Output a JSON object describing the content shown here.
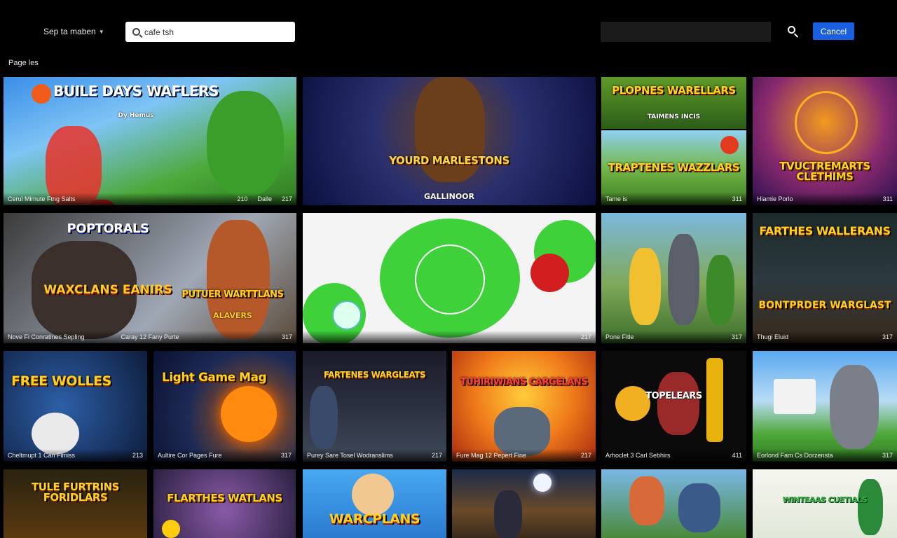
{
  "header": {
    "nav_label": "Sep ta maben",
    "search": {
      "value": "cafe tsh"
    },
    "cancel_label": "Cancel"
  },
  "section_title": "Page les",
  "tiles": [
    {
      "title": "BUILE DAYS WAFLERS",
      "sub": "Dy Hemus",
      "caption_left": "Cerul Mimute Ftng Salts",
      "caption_mid": "210",
      "caption_mid2": "Dalle",
      "caption_right": "217"
    },
    {
      "title": "YOURD MARLESTONS",
      "sub": "GALLINOOR",
      "caption_left": "",
      "caption_mid": "",
      "caption_right": ""
    },
    {
      "title": "PLOPNES WARELLARS",
      "sub": "TAIMENS INCIS",
      "caption_left": "",
      "caption_mid": "",
      "caption_right": ""
    },
    {
      "title": "TRAPTENES WAZZLARS",
      "sub": "",
      "caption_left": "Tame is",
      "caption_mid": "",
      "caption_right": "311"
    },
    {
      "title": "TVUCTREMARTS CLETHIMS",
      "sub": "",
      "caption_left": "Hiamle Porlo",
      "caption_mid": "",
      "caption_right": "311"
    },
    {
      "title": "POPTORALS",
      "sub": "WAXCLANS EANIRS",
      "caption_left": "Nove Fi Conratines Sepling",
      "caption_mid": "",
      "caption_right": ""
    },
    {
      "title": "PUTUER WARTTLANS",
      "sub": "ALAVERS",
      "caption_left": "Caray 12 Fany Purte",
      "caption_mid": "",
      "caption_right": "317"
    },
    {
      "title": "",
      "sub": "",
      "caption_left": "",
      "caption_mid": "",
      "caption_right": "217"
    },
    {
      "title": "",
      "sub": "",
      "caption_left": "Pone Fitle",
      "caption_mid": "",
      "caption_right": "317"
    },
    {
      "title": "FARTHES WALLERANS",
      "sub": "BONTPRDER WARGLAST",
      "caption_left": "Thugi Eluid",
      "caption_mid": "",
      "caption_right": "317"
    },
    {
      "title": "FREE WOLLES",
      "sub": "",
      "caption_left": "Cheltmupt 1 Can Fimiss",
      "caption_mid": "",
      "caption_right": "213"
    },
    {
      "title": "Light Game Mag",
      "sub": "",
      "caption_left": "Aultire Cor Pages Fure",
      "caption_mid": "",
      "caption_right": "317"
    },
    {
      "title": "FARTENES WARGLEATS",
      "sub": "",
      "caption_left": "Purey Sare Tosel Wodranslims",
      "caption_mid": "",
      "caption_right": "217"
    },
    {
      "title": "TUHIRIWIANS CARGELANS",
      "sub": "",
      "caption_left": "Fure Mag 12 Pepert Fine",
      "caption_mid": "",
      "caption_right": "217"
    },
    {
      "title": "TOPELEARS",
      "sub": "",
      "caption_left": "Arhoclet 3 Carl Sebhirs",
      "caption_mid": "",
      "caption_right": "411"
    },
    {
      "title": "",
      "sub": "",
      "caption_left": "Eorlond Fam Cs Dorzensta",
      "caption_mid": "",
      "caption_right": "317"
    },
    {
      "title": "TULE FURTRINS FORIDLARS",
      "sub": "",
      "caption_left": "",
      "caption_mid": "",
      "caption_right": ""
    },
    {
      "title": "FLARTHES WATLANS",
      "sub": "",
      "caption_left": "",
      "caption_mid": "",
      "caption_right": ""
    },
    {
      "title": "WARCPLANS",
      "sub": "",
      "caption_left": "",
      "caption_mid": "",
      "caption_right": ""
    },
    {
      "title": "",
      "sub": "",
      "caption_left": "",
      "caption_mid": "",
      "caption_right": ""
    },
    {
      "title": "",
      "sub": "",
      "caption_left": "",
      "caption_mid": "",
      "caption_right": ""
    },
    {
      "title": "WINTEAAS CUETIALS",
      "sub": "",
      "caption_left": "",
      "caption_mid": "",
      "caption_right": ""
    }
  ]
}
